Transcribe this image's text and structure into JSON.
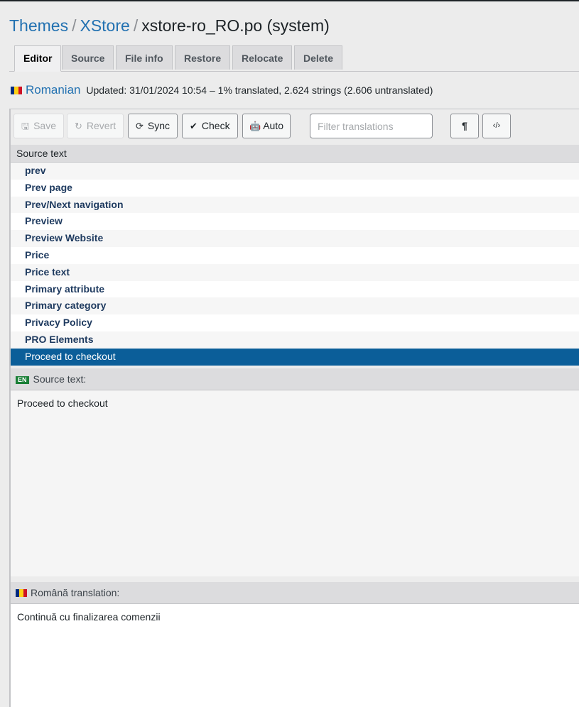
{
  "breadcrumb": {
    "items": [
      "Themes",
      "XStore"
    ],
    "current": "xstore-ro_RO.po (system)",
    "separator": "/"
  },
  "tabs": [
    {
      "label": "Editor",
      "active": true
    },
    {
      "label": "Source"
    },
    {
      "label": "File info"
    },
    {
      "label": "Restore"
    },
    {
      "label": "Relocate"
    },
    {
      "label": "Delete"
    }
  ],
  "status": {
    "flag_colors": [
      "#002B7F",
      "#FCD116",
      "#CE1126"
    ],
    "language": "Romanian",
    "text": "Updated: 31/01/2024 10:54 – 1% translated, 2.624 strings (2.606 untranslated)"
  },
  "toolbar": {
    "save": {
      "label": "Save",
      "icon": "floppy-icon",
      "glyph": "🖫",
      "disabled": true
    },
    "revert": {
      "label": "Revert",
      "icon": "revert-icon",
      "glyph": "↻",
      "disabled": true
    },
    "sync": {
      "label": "Sync",
      "icon": "sync-icon",
      "glyph": "⟳"
    },
    "check": {
      "label": "Check",
      "icon": "check-icon",
      "glyph": "✔"
    },
    "auto": {
      "label": "Auto",
      "icon": "robot-icon",
      "glyph": "🤖"
    },
    "filter_placeholder": "Filter translations",
    "invisibles": {
      "glyph": "¶"
    },
    "code_view": {
      "glyph": "‹/›"
    }
  },
  "list": {
    "header": "Source text",
    "rows": [
      "prev",
      "Prev page",
      "Prev/Next navigation",
      "Preview",
      "Preview Website",
      "Price",
      "Price text",
      "Primary attribute",
      "Primary category",
      "Privacy Policy",
      "PRO Elements",
      "Proceed to checkout"
    ],
    "selected_index": 11
  },
  "source_pane": {
    "badge": "EN",
    "label": "Source text:",
    "text": "Proceed to checkout"
  },
  "translation_pane": {
    "label": "Română translation:",
    "text": "Continuă cu finalizarea comenzii"
  },
  "colors": {
    "link": "#2271b1",
    "selected_row": "#0b5e99",
    "row_text": "#1e3a5f"
  }
}
